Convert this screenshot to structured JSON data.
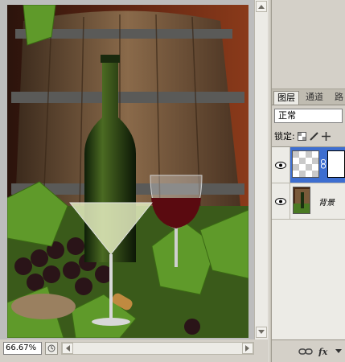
{
  "document": {
    "zoom": "66.67%",
    "image_description": "wine bottle, glasses, barrel and grapes"
  },
  "layers_panel": {
    "tabs": [
      {
        "label": "图层",
        "active": true
      },
      {
        "label": "通道",
        "active": false
      },
      {
        "label": "路",
        "active": false
      }
    ],
    "blend_mode": "正常",
    "lock_label": "锁定:",
    "layers": [
      {
        "name": "",
        "selected": true
      },
      {
        "name": "背景",
        "selected": false
      }
    ],
    "bottom_icons": [
      "link-icon",
      "fx-icon"
    ]
  },
  "colors": {
    "selection": "#3d6ed0",
    "ui_gray": "#d4d0c8"
  }
}
